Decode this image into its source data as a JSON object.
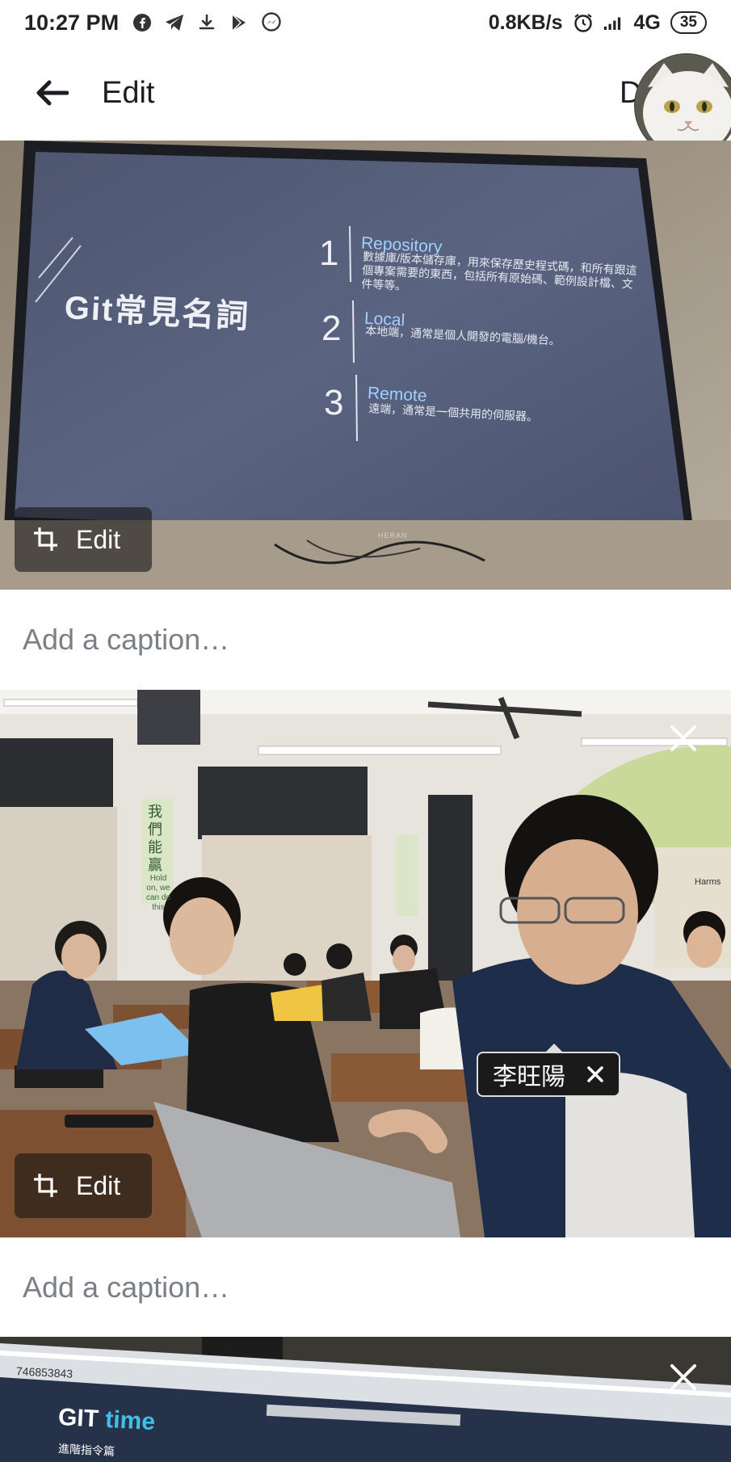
{
  "status_bar": {
    "time": "10:27 PM",
    "left_icons": [
      "facebook-icon",
      "telegram-icon",
      "download-icon",
      "play-store-icon",
      "messenger-icon"
    ],
    "speed": "0.8KB/s",
    "network": "4G",
    "battery": "35"
  },
  "header": {
    "title": "Edit",
    "right_letter": "D"
  },
  "photo1": {
    "tv_title": "Git常見名詞",
    "items": [
      {
        "num": "1",
        "head": "Repository",
        "body": "數據庫/版本儲存庫，用來保存歷史程式碼，和所有跟這個專案需要的東西，包括所有原始碼、範例設計檔、文件等等。"
      },
      {
        "num": "2",
        "head": "Local",
        "body": "本地端，通常是個人開發的電腦/機台。"
      },
      {
        "num": "3",
        "head": "Remote",
        "body": "遠端，通常是一個共用的伺服器。"
      }
    ],
    "brand": "HERAN",
    "edit_label": "Edit",
    "caption_placeholder": "Add a caption…"
  },
  "photo2": {
    "poster_lines": [
      "Hold",
      "on, we",
      "can do",
      "this"
    ],
    "poster_cn": "我們能贏",
    "board_label": "Harms",
    "tag_name": "李旺陽",
    "edit_label": "Edit",
    "caption_placeholder": "Add a caption…"
  },
  "photo3": {
    "number_text": "746853843",
    "title_a": "GIT",
    "title_b": "time",
    "subtitle": "進階指令篇"
  },
  "colors": {
    "tv_screen": "#56607a",
    "text_primary": "#1c1e21",
    "placeholder": "#7b7f86",
    "chip_bg": "#141414",
    "accent_cyan": "#3fc0e8"
  }
}
